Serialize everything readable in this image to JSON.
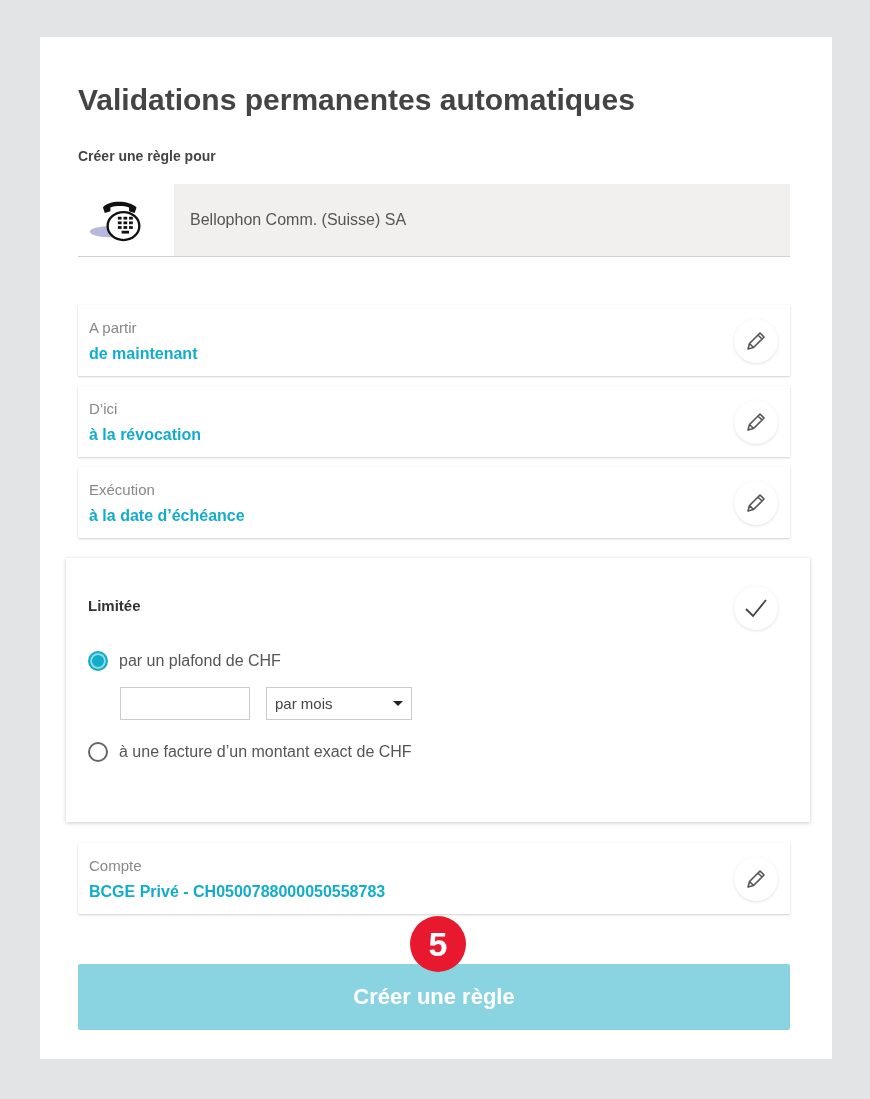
{
  "page": {
    "title": "Validations permanentes automatiques",
    "subtitle": "Créer une règle pour"
  },
  "payee": {
    "name": "Bellophon Comm. (Suisse) SA"
  },
  "settings": [
    {
      "label": "A partir",
      "value": "de maintenant"
    },
    {
      "label": "D’ici",
      "value": "à la révocation"
    },
    {
      "label": "Exécution",
      "value": "à la date d’échéance"
    }
  ],
  "limit": {
    "title": "Limitée",
    "options": [
      {
        "kind": "ceiling",
        "label": "par un plafond de CHF",
        "selected": true,
        "period": "par mois"
      },
      {
        "kind": "exact",
        "label": "à une facture d’un montant exact de CHF",
        "selected": false
      }
    ]
  },
  "account": {
    "label": "Compte",
    "value": "BCGE Privé - CH0500788000050558783"
  },
  "submit": {
    "label": "Créer une règle",
    "badge": "5"
  }
}
